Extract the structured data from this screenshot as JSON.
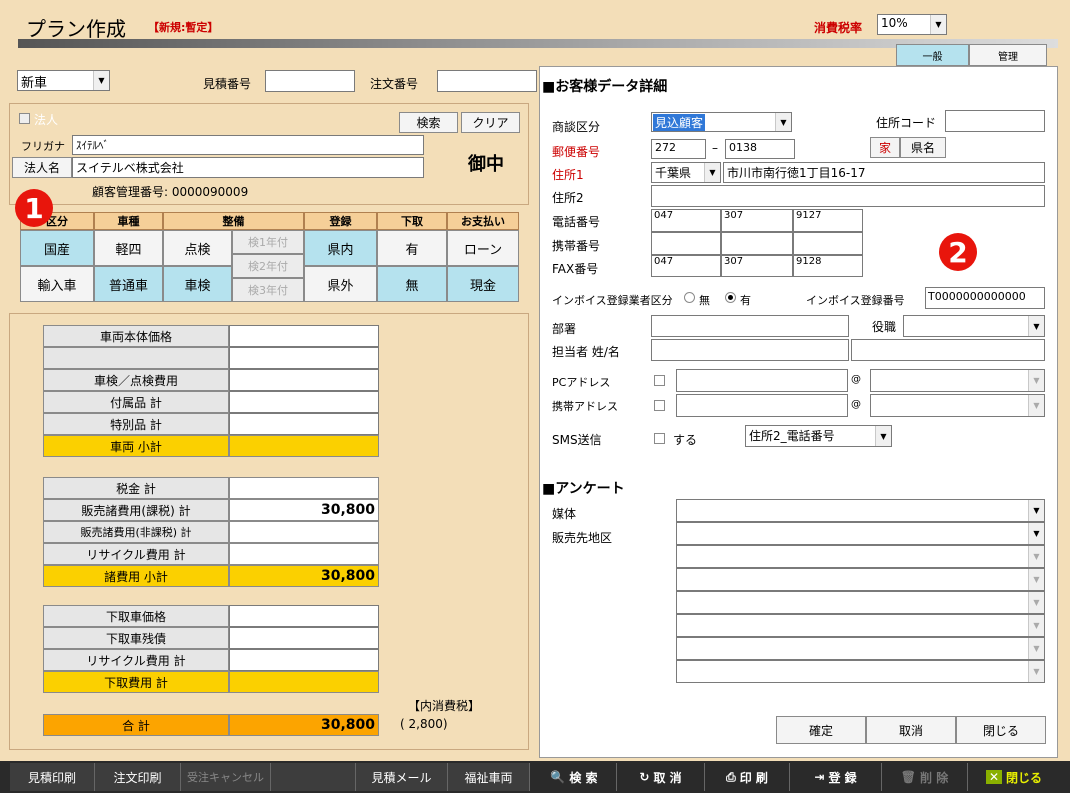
{
  "header": {
    "title": "プラン作成",
    "status": "【新規:暫定】",
    "tax_label": "消費税率",
    "tax_value": "10%"
  },
  "tabs": {
    "general": "一般",
    "admin": "管理"
  },
  "left": {
    "car_type": "新車",
    "estimate_no_label": "見積番号",
    "estimate_no": "",
    "order_no_label": "注文番号",
    "order_no": "",
    "corp_check": "法人",
    "search": "検索",
    "clear": "クリア",
    "furigana_label": "フリガナ",
    "furigana": "ｽｲﾃﾙﾍﾞ",
    "corp_name_btn": "法人名",
    "corp_name": "スイテルベ株式会社",
    "honorific": "御中",
    "customer_no": "顧客管理番号:  0000090009",
    "grid_headers": [
      "区分",
      "車種",
      "整備",
      "登録",
      "下取",
      "お支払い"
    ],
    "grid_row1": [
      "国産",
      "軽四",
      "点検",
      "検1年付",
      "県内",
      "有",
      "ローン"
    ],
    "grid_row2": [
      "輸入車",
      "普通車",
      "車検",
      "検2年付",
      "検3年付",
      "県外",
      "無",
      "現金"
    ]
  },
  "price": {
    "rows1": [
      "車両本体価格",
      "",
      "車検／点検費用",
      "付属品 計",
      "特別品 計"
    ],
    "subtotal1": "車両 小計",
    "rows2": [
      "税金 計",
      "販売諸費用(課税) 計",
      "販売諸費用(非課税) 計",
      "リサイクル費用 計"
    ],
    "rows2_values": [
      "",
      "30,800",
      "",
      ""
    ],
    "subtotal2": "諸費用 小計",
    "subtotal2_value": "30,800",
    "rows3": [
      "下取車価格",
      "下取車残債",
      "リサイクル費用 計"
    ],
    "subtotal3": "下取費用 計",
    "inner_tax_label": "【内消費税】",
    "inner_tax": "(     2,800)",
    "total_label": "合 計",
    "total_value": "30,800"
  },
  "customer": {
    "section_title": "■お客様データ詳細",
    "deal_label": "商談区分",
    "deal_value": "見込顧客",
    "address_code_label": "住所コード",
    "address_code": "",
    "postal_label": "郵便番号",
    "postal1": "272",
    "postal2": "0138",
    "home_btn": "家",
    "pref_btn": "県名",
    "address1_label": "住所1",
    "pref": "千葉県",
    "address1": "市川市南行徳1丁目16-17",
    "address2_label": "住所2",
    "address2": "",
    "phone_label": "電話番号",
    "phone": [
      "047",
      "307",
      "9127"
    ],
    "mobile_label": "携帯番号",
    "fax_label": "FAX番号",
    "fax": [
      "047",
      "307",
      "9128"
    ],
    "invoice_type_label": "インボイス登録業者区分",
    "invoice_none": "無",
    "invoice_yes": "有",
    "invoice_no_label": "インボイス登録番号",
    "invoice_no": "T0000000000000",
    "dept_label": "部署",
    "position_label": "役職",
    "person_label": "担当者 姓/名",
    "pc_label": "PCアドレス",
    "mobile_addr_label": "携帯アドレス",
    "at": "@",
    "sms_label": "SMS送信",
    "sms_check": "する",
    "sms_select": "住所2_電話番号",
    "survey_title": "■アンケート",
    "media_label": "媒体",
    "area_label": "販売先地区",
    "confirm": "確定",
    "cancel": "取消",
    "close": "閉じる"
  },
  "badges": [
    "1",
    "2"
  ],
  "footer": {
    "left": [
      "見積印刷",
      "注文印刷",
      "受注キャンセル",
      "",
      "見積メール",
      "福祉車両"
    ],
    "right": [
      "検 索",
      "取 消",
      "印 刷",
      "登 録",
      "削 除",
      "閉じる"
    ]
  },
  "colors": {
    "bg": "#f3deb8",
    "header_red": "#cc0000",
    "accent_blue": "#b5e2ee",
    "yellow": "#fbd000",
    "total_orange": "#fca400",
    "footer_dark": "#333333",
    "close_green": "#8ab000"
  }
}
